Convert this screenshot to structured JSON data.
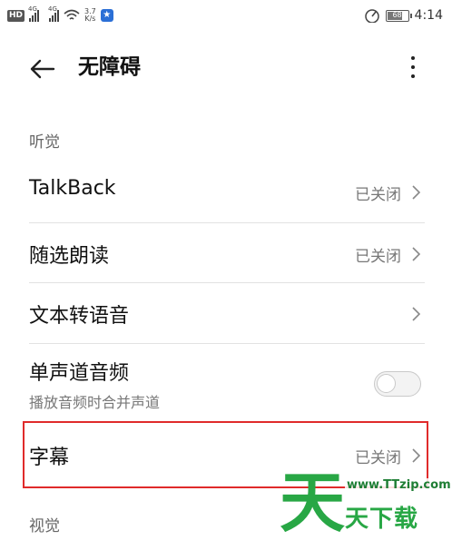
{
  "status_bar": {
    "hd_badge": "HD",
    "network_type_1": "4G",
    "network_type_2": "4G",
    "speed_value": "3.7",
    "speed_unit": "K/s",
    "battery_level": "68",
    "time": "4:14"
  },
  "header": {
    "title": "无障碍"
  },
  "sections": {
    "hearing": "听觉",
    "vision": "视觉"
  },
  "items": [
    {
      "label": "TalkBack",
      "value": "已关闭"
    },
    {
      "label": "随选朗读",
      "value": "已关闭"
    },
    {
      "label": "文本转语音",
      "value": ""
    },
    {
      "label": "单声道音频",
      "sub": "播放音频时合并声道",
      "toggle_on": false
    },
    {
      "label": "字幕",
      "value": "已关闭"
    }
  ],
  "watermark": {
    "logo": "天",
    "url": "www.TTzip.com",
    "text": "天下载"
  },
  "colors": {
    "highlight_border": "#e02b2b",
    "watermark": "#28a745"
  }
}
